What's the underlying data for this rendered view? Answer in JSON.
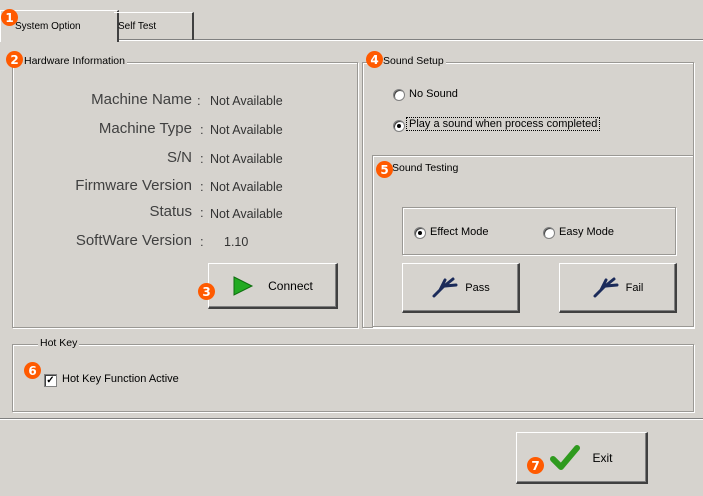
{
  "tabs": [
    {
      "label": "System Option",
      "active": true
    },
    {
      "label": "Self Test",
      "active": false
    }
  ],
  "badges": [
    "1",
    "2",
    "3",
    "4",
    "5",
    "6",
    "7"
  ],
  "hardware": {
    "title": "Hardware Information",
    "rows": [
      {
        "label": "Machine Name",
        "value": "Not Available"
      },
      {
        "label": "Machine Type",
        "value": "Not Available"
      },
      {
        "label": "S/N",
        "value": "Not Available"
      },
      {
        "label": "Firmware Version",
        "value": "Not Available"
      },
      {
        "label": "Status",
        "value": "Not Available"
      },
      {
        "label": "SoftWare Version",
        "value": "1.10"
      }
    ],
    "colon": ":",
    "connect_label": "Connect"
  },
  "sound_setup": {
    "title": "Sound Setup",
    "no_sound_label": "No Sound",
    "play_sound_label": "Play a sound when process completed",
    "selected": "play_sound"
  },
  "sound_testing": {
    "title": "Sound Testing",
    "effect_mode_label": "Effect Mode",
    "easy_mode_label": "Easy  Mode",
    "selected": "effect_mode",
    "pass_label": "Pass",
    "fail_label": "Fail"
  },
  "hotkey": {
    "title": "Hot Key",
    "checkbox_label": "Hot Key Function Active",
    "checked": true,
    "check_mark": "✓"
  },
  "exit_label": "Exit",
  "colors": {
    "window_bg": "#d6d3ce",
    "badge": "#ff5a00",
    "play_icon": "#22aa22",
    "check_icon": "#2f9a1e"
  }
}
